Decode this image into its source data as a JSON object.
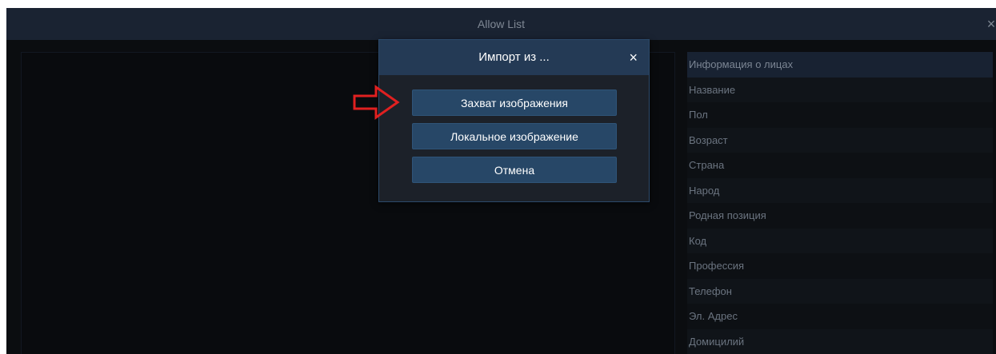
{
  "window": {
    "title": "Allow List",
    "close_glyph": "×"
  },
  "info_panel": {
    "header": "Информация о лицах",
    "fields": [
      "Название",
      "Пол",
      "Возраст",
      "Страна",
      "Народ",
      "Родная позиция",
      "Код",
      "Профессия",
      "Телефон",
      "Эл. Адрес",
      "Домицилий"
    ]
  },
  "modal": {
    "title": "Импорт из ...",
    "close_glyph": "×",
    "buttons": {
      "capture": "Захват изображения",
      "local": "Локальное изображение",
      "cancel": "Отмена"
    }
  },
  "annotation": {
    "arrow_icon": "red-outline-arrow-right-icon",
    "color": "#e02020"
  }
}
